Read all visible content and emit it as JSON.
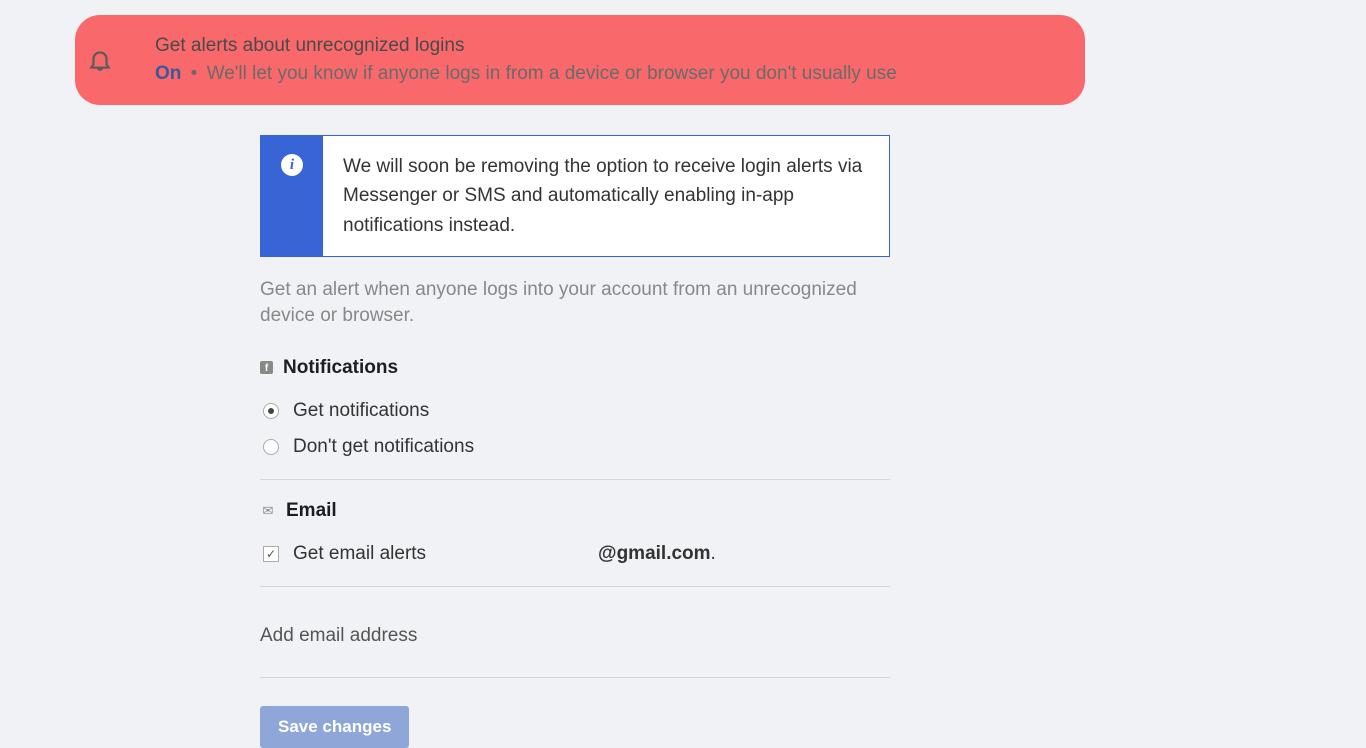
{
  "banner": {
    "title": "Get alerts about unrecognized logins",
    "status": "On",
    "description": "We'll let you know if anyone logs in from a device or browser you don't usually use"
  },
  "infoBox": {
    "text": "We will soon be removing the option to receive login alerts via Messenger or SMS and automatically enabling in-app notifications instead."
  },
  "description": "Get an alert when anyone logs into your account from an unrecognized device or browser.",
  "notifications": {
    "header": "Notifications",
    "options": {
      "get": "Get notifications",
      "dont": "Don't get notifications"
    }
  },
  "email": {
    "header": "Email",
    "checkboxLabel": "Get email alerts",
    "address": "@gmail.com",
    "addLabel": "Add email address"
  },
  "saveButton": "Save changes"
}
